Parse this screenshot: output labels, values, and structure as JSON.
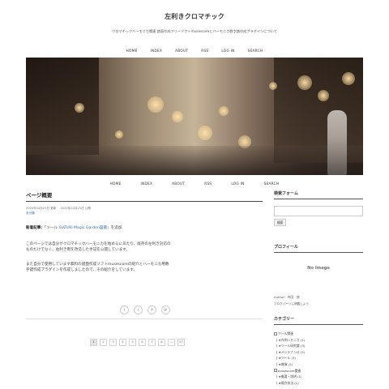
{
  "header": {
    "site_title": "左利きクロマチック",
    "site_description": "クロマチックハーモニカ関連 譜面作成フリーソフトmusescoreとハーモニカ数字譜作成プラグインについて"
  },
  "nav": {
    "items": [
      "HOME",
      "INDEX",
      "ABOUT",
      "RSS",
      "LOG IN",
      "SEARCH"
    ]
  },
  "article": {
    "title": "ページ概要",
    "updated": "2020年03月25日 更新",
    "posted": "2020年03月25日 公開",
    "category": "未分類",
    "p1_label": "新着記事：",
    "p1_prefix": "「ツール ",
    "p1_link": "SUZUKI Magic Garden図書」",
    "p1_suffix": "を追加",
    "p2": "このページでは自分がクロマチックハーモニカを始めるにあたり、既存の左利き対応のものだけでなく、右利き用を改造した手記を公開しています。",
    "p3": "また自分で使用しています無料の譜面作成ソフトmusescoreの紹介とハーモニカ用数字譜作成プラグインを作成しましたので、その紹介をしています。"
  },
  "share": {
    "icons": [
      "f",
      "t",
      "P",
      "B!"
    ]
  },
  "pagination": {
    "pages": [
      "1",
      "2",
      "3",
      "4",
      "5",
      "6",
      "7",
      "8",
      "...",
      "27"
    ]
  },
  "sidebar": {
    "search_title": "検索フォーム",
    "search_button": "検索",
    "profile_title": "プロフィール",
    "profile_image_text": "No Image",
    "author_line": "Author：寺田　修",
    "author_link": "ブログパーツに掲載しよう",
    "category_title": "カテゴリー",
    "categories": [
      {
        "label": "ツール関連",
        "child": false
      },
      {
        "label": "├ ★作例ハモニカ (1)",
        "child": true
      },
      {
        "label": "├ ★ツール研究論 (3)",
        "child": true
      },
      {
        "label": "├ ★メンテナンス (2)",
        "child": true
      },
      {
        "label": "├ ★ツール (3)",
        "child": true
      },
      {
        "label": "├ ★雑貨 (1)",
        "child": true
      },
      {
        "label": "musescore関連",
        "child": false
      },
      {
        "label": "├ ★概要・説明 (1)",
        "child": true
      },
      {
        "label": "├ ★操作技法 (1)",
        "child": true
      }
    ]
  }
}
